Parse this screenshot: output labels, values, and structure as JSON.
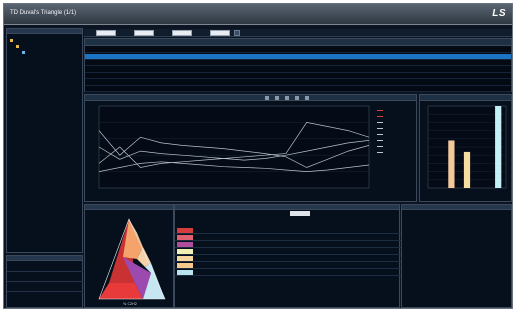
{
  "app": {
    "title": "TD Duval's Triangle (1/1)",
    "brand": "LS"
  },
  "toolbar": {
    "fields": [
      "",
      "",
      "",
      ""
    ],
    "button_count": 5
  },
  "tree": {
    "nodes": [
      "",
      "",
      ""
    ]
  },
  "properties": {
    "rows": [
      {
        "name": "",
        "value": ""
      },
      {
        "name": "",
        "value": ""
      },
      {
        "name": "",
        "value": ""
      }
    ]
  },
  "grid": {
    "columns": [
      "",
      "",
      "",
      "",
      "",
      "",
      "",
      "",
      "",
      "",
      ""
    ],
    "rows": [
      {
        "selected": false
      },
      {
        "selected": true
      },
      {
        "selected": false
      },
      {
        "selected": false
      },
      {
        "selected": false
      },
      {
        "selected": false
      },
      {
        "selected": false
      }
    ]
  },
  "colors": {
    "accent_selected": "#1c74c4",
    "background": "#0b1420",
    "panel_border": "#3a4a5c",
    "line_series": "#b9c2cc"
  },
  "chart_data": [
    {
      "type": "line",
      "title": "",
      "xlabel": "",
      "ylabel": "",
      "x": [
        0,
        1,
        2,
        3,
        4,
        5,
        6,
        7,
        8,
        9,
        10,
        11,
        12,
        13
      ],
      "ylim": [
        0,
        100
      ],
      "grid": true,
      "legend": "right",
      "series": [
        {
          "values": [
            30,
            50,
            25,
            30,
            32,
            34,
            36,
            38,
            40,
            42,
            80,
            75,
            70,
            62
          ]
        },
        {
          "values": [
            70,
            40,
            62,
            55,
            52,
            50,
            48,
            45,
            42,
            38,
            25,
            35,
            45,
            52
          ]
        },
        {
          "values": [
            50,
            35,
            45,
            42,
            40,
            38,
            36,
            34,
            36,
            40,
            45,
            50,
            55,
            58
          ]
        },
        {
          "values": [
            20,
            25,
            30,
            32,
            30,
            28,
            26,
            25,
            24,
            22,
            20,
            22,
            25,
            28
          ]
        }
      ]
    },
    {
      "type": "bar",
      "title": "",
      "categories": [
        "",
        "",
        "",
        "",
        ""
      ],
      "values": [
        0,
        58,
        44,
        0,
        100
      ],
      "colors": [
        "#f2c99a",
        "#f2c99a",
        "#f5dfa0",
        "#b0e8f0",
        "#c2f0f6"
      ],
      "ylim": [
        0,
        100
      ],
      "grid": true
    }
  ],
  "duval": {
    "zones": [
      {
        "color": "#c83232"
      },
      {
        "color": "#e83a3a"
      },
      {
        "color": "#9c4ab0"
      },
      {
        "color": "#f4a36c"
      },
      {
        "color": "#f6d2a8"
      },
      {
        "color": "#c6e6f2"
      },
      {
        "color": "#f3f0b6"
      }
    ],
    "axis_label": "% C2H2"
  },
  "zone_list": {
    "rows": [
      {
        "color": "#d63c3c",
        "label": ""
      },
      {
        "color": "#e06070",
        "label": ""
      },
      {
        "color": "#b04c9c",
        "label": ""
      },
      {
        "color": "#f2efb4",
        "label": ""
      },
      {
        "color": "#f6d69c",
        "label": ""
      },
      {
        "color": "#f7c98a",
        "label": ""
      },
      {
        "color": "#b8e2ee",
        "label": ""
      }
    ]
  }
}
